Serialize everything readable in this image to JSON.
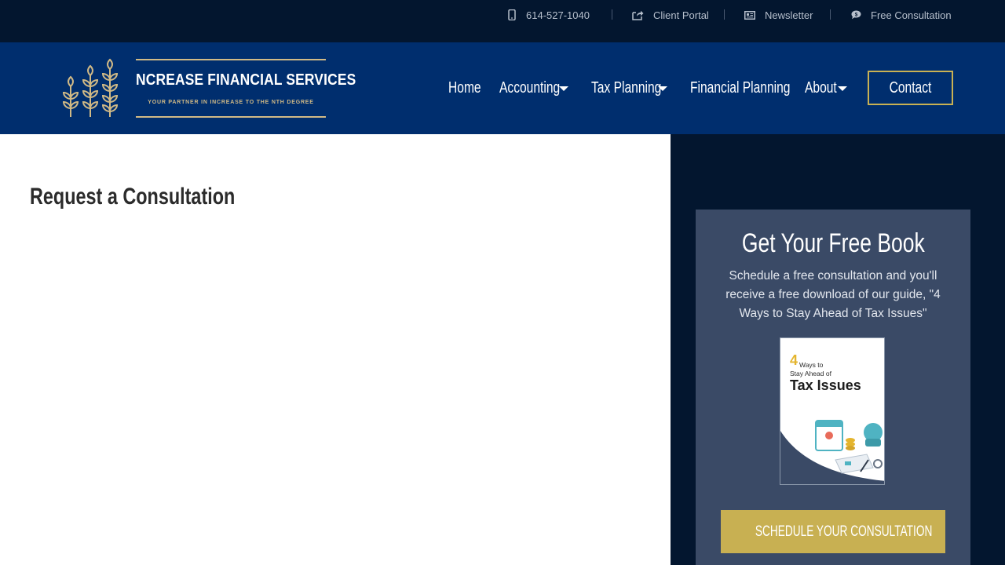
{
  "utility_bar": {
    "phone": "614-527-1040",
    "client_portal": "Client Portal",
    "newsletter": "Newsletter",
    "free_consultation": "Free Consultation"
  },
  "logo": {
    "name": "NCREASE FINANCIAL SERVICES",
    "tagline": "YOUR PARTNER IN INCREASE TO THE NTH DEGREE",
    "icon": "wheat-stalks-icon"
  },
  "nav": {
    "home": "Home",
    "accounting": "Accounting",
    "tax_planning": "Tax Planning",
    "financial_planning": "Financial Planning",
    "about": "About",
    "contact": "Contact"
  },
  "main": {
    "title": "Request a Consultation"
  },
  "promo": {
    "title": "Get Your Free Book",
    "description": "Schedule a free consultation and you'll receive a free download of our guide, \"4 Ways to Stay Ahead of Tax Issues\"",
    "book_number": "4",
    "book_subtitle_line1": "Ways to",
    "book_subtitle_line2": "Stay Ahead of",
    "book_title": "Tax Issues",
    "cta": "SCHEDULE YOUR CONSULTATION"
  },
  "colors": {
    "topbar": "#03162f",
    "navbar": "#002e6e",
    "gold": "#c8b052",
    "logo_gold": "#d1ba86",
    "promo_panel": "#3a4a66"
  }
}
